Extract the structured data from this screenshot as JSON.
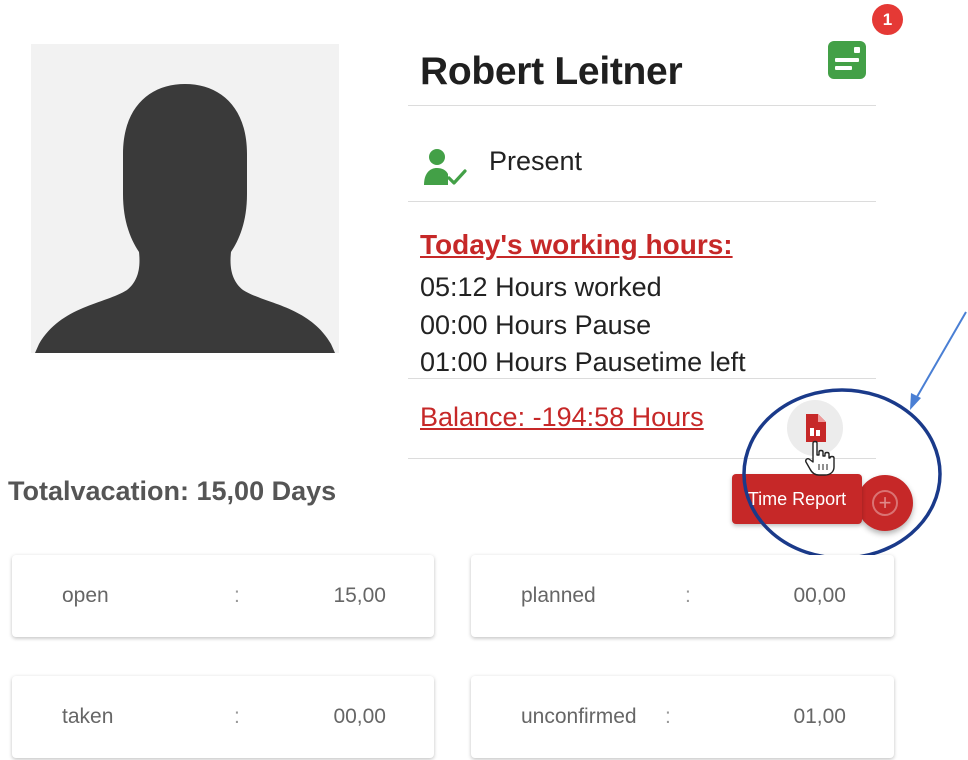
{
  "profile": {
    "name": "Robert Leitner",
    "status": "Present",
    "notification_count": "1"
  },
  "working_hours": {
    "title": "Today's working hours:",
    "worked": "05:12 Hours worked",
    "pause": "00:00 Hours Pause",
    "pause_left": "01:00 Hours Pausetime left",
    "balance": "Balance: -194:58 Hours"
  },
  "vacation": {
    "total": "Totalvacation: 15,00 Days",
    "cards": [
      {
        "label": "open",
        "sep": ":",
        "value": "15,00"
      },
      {
        "label": "planned",
        "sep": ":",
        "value": "00,00"
      },
      {
        "label": "taken",
        "sep": ":",
        "value": "00,00"
      },
      {
        "label": "unconfirmed",
        "sep": ":",
        "value": "01,00"
      }
    ]
  },
  "actions": {
    "time_report": "Time Report",
    "fab_icon": "plus-circle-icon",
    "pdf_icon": "pdf-file-icon"
  },
  "colors": {
    "accent_red": "#c62828",
    "status_green": "#43a047",
    "annotation_blue": "#1a3a8a"
  }
}
